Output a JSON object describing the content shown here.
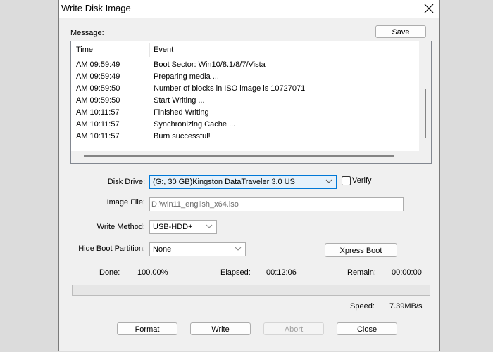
{
  "window": {
    "title": "Write Disk Image",
    "close_icon": "close-icon"
  },
  "message": {
    "label": "Message:",
    "save_button": "Save",
    "columns": [
      "Time",
      "Event"
    ],
    "rows": [
      {
        "time": "AM 09:59:49",
        "event": "Boot Sector: Win10/8.1/8/7/Vista"
      },
      {
        "time": "AM 09:59:49",
        "event": "Preparing media ..."
      },
      {
        "time": "AM 09:59:50",
        "event": "Number of blocks in ISO image is 10727071"
      },
      {
        "time": "AM 09:59:50",
        "event": "Start Writing ..."
      },
      {
        "time": "AM 10:11:57",
        "event": "Finished Writing"
      },
      {
        "time": "AM 10:11:57",
        "event": "Synchronizing Cache ..."
      },
      {
        "time": "AM 10:11:57",
        "event": "Burn successful!"
      }
    ]
  },
  "form": {
    "disk_drive_label": "Disk Drive:",
    "disk_drive_value": "(G:, 30 GB)Kingston DataTraveler 3.0 US",
    "verify_label": "Verify",
    "verify_checked": false,
    "image_file_label": "Image File:",
    "image_file_value": "D:\\win11_english_x64.iso",
    "write_method_label": "Write Method:",
    "write_method_value": "USB-HDD+",
    "hide_boot_label": "Hide Boot Partition:",
    "hide_boot_value": "None",
    "xpress_boot_button": "Xpress Boot"
  },
  "status": {
    "done_label": "Done:",
    "done_value": "100.00%",
    "elapsed_label": "Elapsed:",
    "elapsed_value": "00:12:06",
    "remain_label": "Remain:",
    "remain_value": "00:00:00",
    "speed_label": "Speed:",
    "speed_value": "7.39MB/s",
    "progress_percent": 100
  },
  "buttons": {
    "format": "Format",
    "write": "Write",
    "abort": "Abort",
    "close": "Close"
  }
}
